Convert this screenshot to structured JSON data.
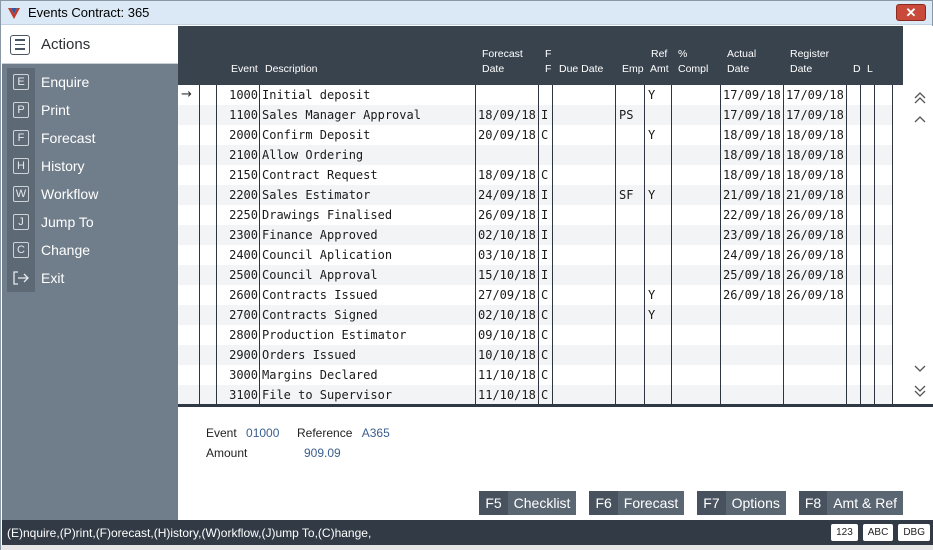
{
  "window": {
    "title": "Events  Contract: 365",
    "close_label": "✕"
  },
  "sidebar": {
    "header": "Actions",
    "items": [
      {
        "key": "E",
        "label": "Enquire"
      },
      {
        "key": "P",
        "label": "Print"
      },
      {
        "key": "F",
        "label": "Forecast"
      },
      {
        "key": "H",
        "label": "History"
      },
      {
        "key": "W",
        "label": "Workflow"
      },
      {
        "key": "J",
        "label": "Jump To"
      },
      {
        "key": "C",
        "label": "Change"
      },
      {
        "key": "",
        "label": "Exit",
        "icon": "exit-arrow-icon"
      }
    ]
  },
  "grid": {
    "columns": {
      "event": "Event",
      "description": "Description",
      "forecast_1": "Forecast",
      "forecast_2": "Date",
      "ff_1": "F",
      "ff_2": "F",
      "due_date": "Due Date",
      "emp": "Emp",
      "ref_1": "Ref",
      "ref_2": "Amt",
      "compl_1": "%",
      "compl_2": "Compl",
      "actual_1": "Actual",
      "actual_2": "Date",
      "register_1": "Register",
      "register_2": "Date",
      "d": "D",
      "l": "L"
    },
    "rows": [
      {
        "event": "1000",
        "description": "Initial deposit",
        "forecast": "",
        "ff": "",
        "due": "",
        "emp": "",
        "ref": "Y",
        "compl": "",
        "actual": "17/09/18",
        "register": "17/09/18"
      },
      {
        "event": "1100",
        "description": "Sales Manager Approval",
        "forecast": "18/09/18",
        "ff": "I",
        "due": "",
        "emp": "PS",
        "ref": "",
        "compl": "",
        "actual": "17/09/18",
        "register": "17/09/18"
      },
      {
        "event": "2000",
        "description": "Confirm Deposit",
        "forecast": "20/09/18",
        "ff": "C",
        "due": "",
        "emp": "",
        "ref": "Y",
        "compl": "",
        "actual": "18/09/18",
        "register": "18/09/18"
      },
      {
        "event": "2100",
        "description": "Allow Ordering",
        "forecast": "",
        "ff": "",
        "due": "",
        "emp": "",
        "ref": "",
        "compl": "",
        "actual": "18/09/18",
        "register": "18/09/18"
      },
      {
        "event": "2150",
        "description": "Contract Request",
        "forecast": "18/09/18",
        "ff": "C",
        "due": "",
        "emp": "",
        "ref": "",
        "compl": "",
        "actual": "18/09/18",
        "register": "18/09/18"
      },
      {
        "event": "2200",
        "description": "Sales Estimator",
        "forecast": "24/09/18",
        "ff": "I",
        "due": "",
        "emp": "SF",
        "ref": "Y",
        "compl": "",
        "actual": "21/09/18",
        "register": "21/09/18"
      },
      {
        "event": "2250",
        "description": "Drawings Finalised",
        "forecast": "26/09/18",
        "ff": "I",
        "due": "",
        "emp": "",
        "ref": "",
        "compl": "",
        "actual": "22/09/18",
        "register": "26/09/18"
      },
      {
        "event": "2300",
        "description": "Finance Approved",
        "forecast": "02/10/18",
        "ff": "I",
        "due": "",
        "emp": "",
        "ref": "",
        "compl": "",
        "actual": "23/09/18",
        "register": "26/09/18"
      },
      {
        "event": "2400",
        "description": "Council Aplication",
        "forecast": "03/10/18",
        "ff": "I",
        "due": "",
        "emp": "",
        "ref": "",
        "compl": "",
        "actual": "24/09/18",
        "register": "26/09/18"
      },
      {
        "event": "2500",
        "description": "Council Approval",
        "forecast": "15/10/18",
        "ff": "I",
        "due": "",
        "emp": "",
        "ref": "",
        "compl": "",
        "actual": "25/09/18",
        "register": "26/09/18"
      },
      {
        "event": "2600",
        "description": "Contracts Issued",
        "forecast": "27/09/18",
        "ff": "C",
        "due": "",
        "emp": "",
        "ref": "Y",
        "compl": "",
        "actual": "26/09/18",
        "register": "26/09/18"
      },
      {
        "event": "2700",
        "description": "Contracts Signed",
        "forecast": "02/10/18",
        "ff": "C",
        "due": "",
        "emp": "",
        "ref": "Y",
        "compl": "",
        "actual": "",
        "register": ""
      },
      {
        "event": "2800",
        "description": "Production Estimator",
        "forecast": "09/10/18",
        "ff": "C",
        "due": "",
        "emp": "",
        "ref": "",
        "compl": "",
        "actual": "",
        "register": ""
      },
      {
        "event": "2900",
        "description": "Orders Issued",
        "forecast": "10/10/18",
        "ff": "C",
        "due": "",
        "emp": "",
        "ref": "",
        "compl": "",
        "actual": "",
        "register": ""
      },
      {
        "event": "3000",
        "description": "Margins Declared",
        "forecast": "11/10/18",
        "ff": "C",
        "due": "",
        "emp": "",
        "ref": "",
        "compl": "",
        "actual": "",
        "register": ""
      },
      {
        "event": "3100",
        "description": "File to Supervisor",
        "forecast": "11/10/18",
        "ff": "C",
        "due": "",
        "emp": "",
        "ref": "",
        "compl": "",
        "actual": "",
        "register": ""
      }
    ]
  },
  "detail": {
    "event_label": "Event",
    "event_value": "01000",
    "reference_label": "Reference",
    "reference_value": "A365",
    "amount_label": "Amount",
    "amount_value": "909.09"
  },
  "function_keys": [
    {
      "key": "F5",
      "label": "Checklist"
    },
    {
      "key": "F6",
      "label": "Forecast"
    },
    {
      "key": "F7",
      "label": "Options"
    },
    {
      "key": "F8",
      "label": "Amt & Ref"
    }
  ],
  "status": {
    "text": "(E)nquire,(P)rint,(F)orecast,(H)istory,(W)orkflow,(J)ump To,(C)hange,",
    "badges": [
      "123",
      "ABC",
      "DBG"
    ]
  }
}
